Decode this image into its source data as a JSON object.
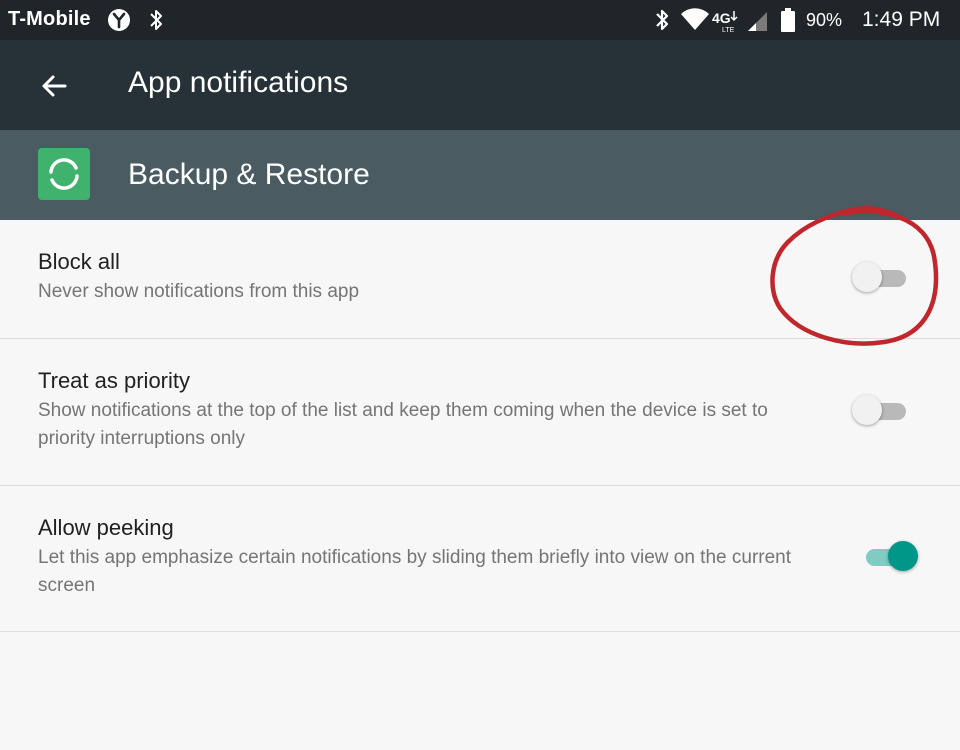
{
  "status_bar": {
    "carrier": "T-Mobile",
    "battery": "90%",
    "time": "1:49 PM"
  },
  "toolbar": {
    "title": "App notifications"
  },
  "app_header": {
    "app_name": "Backup & Restore"
  },
  "settings": {
    "block_all": {
      "title": "Block all",
      "summary": "Never show notifications from this app",
      "enabled": false
    },
    "treat_as_priority": {
      "title": "Treat as priority",
      "summary": "Show notifications at the top of the list and keep them coming when the device is set to priority interruptions only",
      "enabled": false
    },
    "allow_peeking": {
      "title": "Allow peeking",
      "summary": "Let this app emphasize certain notifications by sliding them briefly into view on the current screen",
      "enabled": true
    }
  },
  "colors": {
    "status_bar": "#1f2528",
    "toolbar": "#263238",
    "app_header": "#4a5c62",
    "app_icon": "#3fb36d",
    "toggle_on": "#009688",
    "annotation": "#c0262c"
  }
}
